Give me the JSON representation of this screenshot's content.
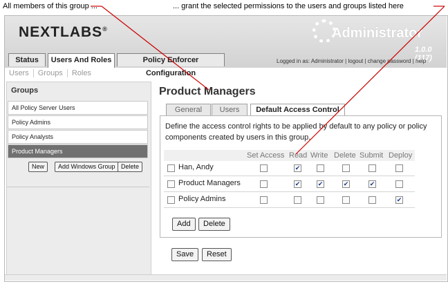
{
  "annotations": {
    "left": "All members of this group ...",
    "right": "... grant the selected permissions to the users and groups listed here"
  },
  "header": {
    "logo": "NEXTLABS",
    "logo_mark": "®",
    "app_title": "Administrator",
    "version": "1.0.0 (117)",
    "user_info": "Logged in as: Administrator  |  logout  |  change password  |  help"
  },
  "main_tabs": [
    {
      "label": "Status"
    },
    {
      "label": "Users And Roles"
    },
    {
      "label": "Policy Enforcer Configuration"
    }
  ],
  "sub_nav": [
    {
      "label": "Users"
    },
    {
      "label": "Groups"
    },
    {
      "label": "Roles"
    }
  ],
  "groups": {
    "title": "Groups",
    "items": [
      {
        "label": "All Policy Server Users"
      },
      {
        "label": "Policy Admins"
      },
      {
        "label": "Policy Analysts"
      },
      {
        "label": "Product Managers"
      }
    ],
    "selected": "Product Managers",
    "buttons": {
      "new": "New",
      "add_windows": "Add Windows Group",
      "delete": "Delete"
    }
  },
  "content": {
    "title": "Product Managers",
    "tabs": [
      {
        "label": "General"
      },
      {
        "label": "Users"
      },
      {
        "label": "Default Access Control"
      }
    ],
    "description": "Define the access control rights to be applied by default to any policy or policy components created by users in this group.",
    "columns": [
      "Set Access",
      "Read",
      "Write",
      "Delete",
      "Submit",
      "Deploy"
    ],
    "rows": [
      {
        "name": "Han, Andy",
        "perms": [
          false,
          true,
          false,
          false,
          false,
          false
        ]
      },
      {
        "name": "Product Managers",
        "perms": [
          false,
          true,
          true,
          true,
          true,
          false
        ]
      },
      {
        "name": "Policy Admins",
        "perms": [
          false,
          false,
          false,
          false,
          false,
          true
        ]
      }
    ],
    "panel_buttons": {
      "add": "Add",
      "delete": "Delete"
    },
    "footer_buttons": {
      "save": "Save",
      "reset": "Reset"
    }
  }
}
